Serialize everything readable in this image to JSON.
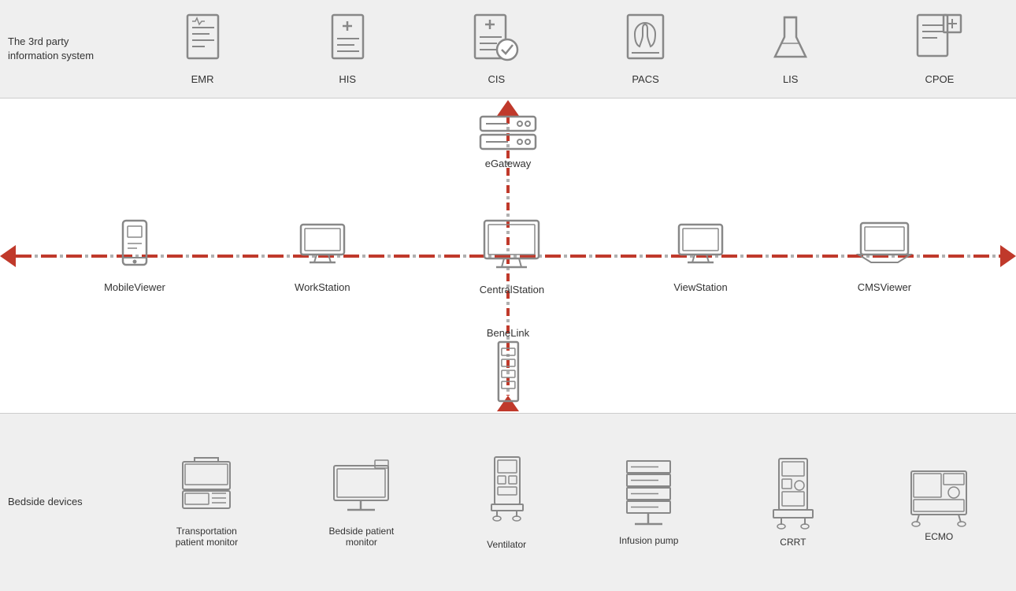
{
  "top": {
    "label": "The 3rd party\ninformation system",
    "systems": [
      {
        "id": "emr",
        "label": "EMR"
      },
      {
        "id": "his",
        "label": "HIS"
      },
      {
        "id": "cis",
        "label": "CIS"
      },
      {
        "id": "pacs",
        "label": "PACS"
      },
      {
        "id": "lis",
        "label": "LIS"
      },
      {
        "id": "cpoe",
        "label": "CPOE"
      }
    ]
  },
  "middle": {
    "egateway": {
      "label": "eGateway"
    },
    "benelink": {
      "label": "BeneLink"
    },
    "devices": [
      {
        "id": "mobile-viewer",
        "label": "MobileViewer"
      },
      {
        "id": "workstation",
        "label": "WorkStation"
      },
      {
        "id": "central-station",
        "label": "CentralStation"
      },
      {
        "id": "view-station",
        "label": "ViewStation"
      },
      {
        "id": "cms-viewer",
        "label": "CMSViewer"
      }
    ]
  },
  "bottom": {
    "label": "Bedside devices",
    "devices": [
      {
        "id": "transport-monitor",
        "label": "Transportation\npatient monitor"
      },
      {
        "id": "bedside-monitor",
        "label": "Bedside patient\nmonitor"
      },
      {
        "id": "ventilator",
        "label": "Ventilator"
      },
      {
        "id": "infusion-pump",
        "label": "Infusion pump"
      },
      {
        "id": "crrt",
        "label": "CRRT"
      },
      {
        "id": "ecmo",
        "label": "ECMO"
      }
    ]
  },
  "colors": {
    "red": "#c0392b",
    "gray": "#888",
    "dark": "#444"
  }
}
